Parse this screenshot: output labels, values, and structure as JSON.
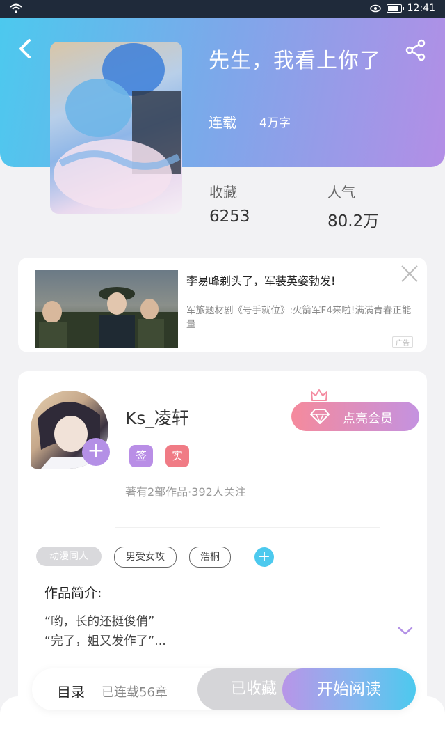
{
  "status_bar": {
    "time": "12:41"
  },
  "book": {
    "title": "先生，我看上你了",
    "status": "连载",
    "word_count": "4万字",
    "stats": [
      {
        "label": "收藏",
        "value": "6253"
      },
      {
        "label": "人气",
        "value": "80.2万"
      }
    ]
  },
  "ad": {
    "title": "李易峰剃头了，军装英姿勃发!",
    "description": "军旅题材剧《号手就位》:火箭军F4来啦!满满青春正能量",
    "tag": "广告"
  },
  "author": {
    "name": "Ks_凌轩",
    "badges": [
      "签",
      "实"
    ],
    "info": "著有2部作品·392人关注",
    "vip_button": "点亮会员"
  },
  "tags": [
    "动漫同人",
    "男受女攻",
    "浩桐"
  ],
  "intro": {
    "label": "作品简介:",
    "lines": [
      "“哟，长的还挺俊俏”",
      "“完了，姐又发作了”..."
    ]
  },
  "bottom_bar": {
    "toc": "目录",
    "chapters": "已连载56章",
    "collected": "已收藏",
    "read": "开始阅读"
  },
  "colors": {
    "header_gradient": [
      "#4cc9ee",
      "#b38ee6"
    ],
    "vip_gradient": [
      "#f58a9c",
      "#c492e0"
    ],
    "badge_sign": "#b98ee6",
    "badge_real": "#f07b85"
  }
}
